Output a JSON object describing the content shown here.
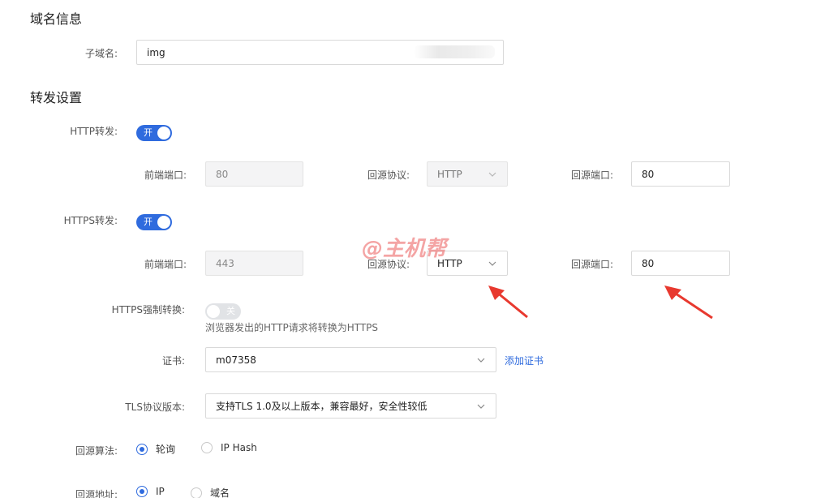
{
  "domain_info": {
    "title": "域名信息",
    "subdomain_label": "子域名:",
    "subdomain_value": "img"
  },
  "forward_settings": {
    "title": "转发设置",
    "http": {
      "label": "HTTP转发:",
      "toggle_text": "开",
      "enabled": true,
      "front_port_label": "前端端口:",
      "front_port_value": "80",
      "origin_protocol_label": "回源协议:",
      "origin_protocol_value": "HTTP",
      "origin_port_label": "回源端口:",
      "origin_port_value": "80"
    },
    "https": {
      "label": "HTTPS转发:",
      "toggle_text": "开",
      "enabled": true,
      "front_port_label": "前端端口:",
      "front_port_value": "443",
      "origin_protocol_label": "回源协议:",
      "origin_protocol_value": "HTTP",
      "origin_port_label": "回源端口:",
      "origin_port_value": "80"
    },
    "force_https": {
      "label": "HTTPS强制转换:",
      "toggle_text": "关",
      "enabled": false,
      "hint": "浏览器发出的HTTP请求将转换为HTTPS"
    },
    "certificate": {
      "label": "证书:",
      "value": "m07358",
      "add_link": "添加证书"
    },
    "tls": {
      "label": "TLS协议版本:",
      "value": "支持TLS 1.0及以上版本，兼容最好，安全性较低"
    },
    "algorithm": {
      "label": "回源算法:",
      "options": [
        "轮询",
        "IP Hash"
      ],
      "selected": "轮询"
    },
    "origin_address": {
      "label": "回源地址:",
      "options": [
        "IP",
        "域名"
      ],
      "selected": "IP"
    }
  },
  "watermark": "@主机帮",
  "colors": {
    "accent": "#2f6bde",
    "arrow": "#e8392f"
  }
}
